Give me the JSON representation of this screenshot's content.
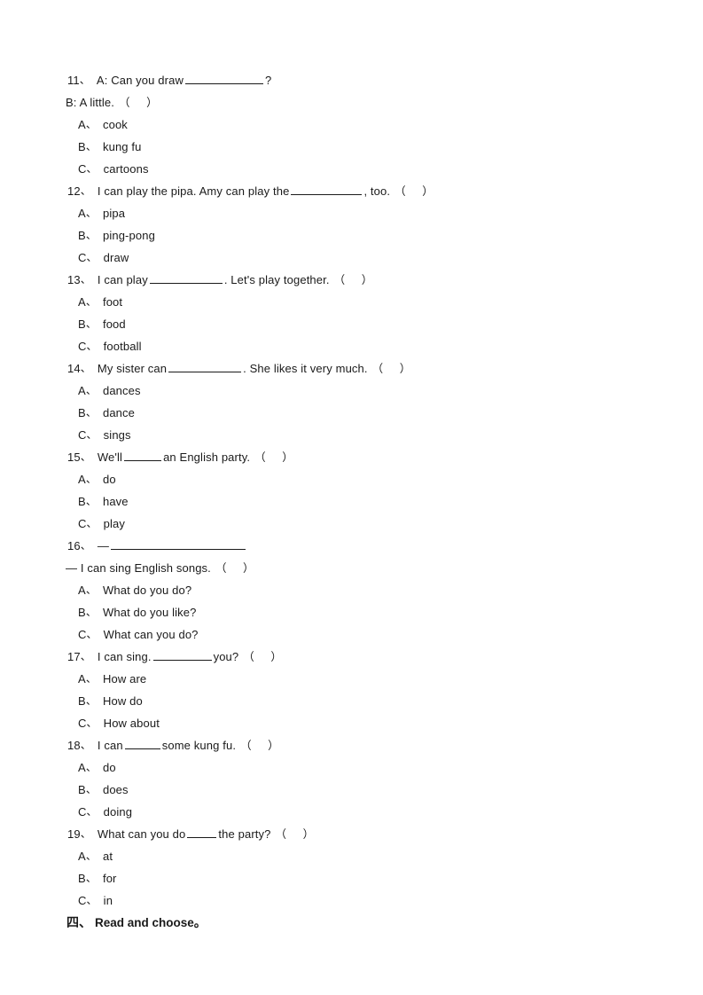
{
  "document": {
    "questions": [
      {
        "number": "11",
        "sep": "、",
        "stem_before": "A: Can you draw",
        "blank_width": 88,
        "stem_after": "?",
        "continuation": "B: A little.",
        "has_bracket_on_continuation": true,
        "options": [
          {
            "letter": "A",
            "sep": "、",
            "text": "cook"
          },
          {
            "letter": "B",
            "sep": "、",
            "text": "kung fu"
          },
          {
            "letter": "C",
            "sep": "、",
            "text": "cartoons"
          }
        ]
      },
      {
        "number": "12",
        "sep": "、",
        "stem_before": "I can play the pipa. Amy can play the",
        "blank_width": 80,
        "stem_after": ", too.",
        "options": [
          {
            "letter": "A",
            "sep": "、",
            "text": "pipa"
          },
          {
            "letter": "B",
            "sep": "、",
            "text": "ping-pong"
          },
          {
            "letter": "C",
            "sep": "、",
            "text": "draw"
          }
        ]
      },
      {
        "number": "13",
        "sep": "、",
        "stem_before": "I can play",
        "blank_width": 82,
        "stem_after": ". Let's play together.",
        "options": [
          {
            "letter": "A",
            "sep": "、",
            "text": "foot"
          },
          {
            "letter": "B",
            "sep": "、",
            "text": "food"
          },
          {
            "letter": "C",
            "sep": "、",
            "text": "football"
          }
        ]
      },
      {
        "number": "14",
        "sep": "、",
        "stem_before": "My sister can",
        "blank_width": 82,
        "stem_after": ". She likes it very much.",
        "options": [
          {
            "letter": "A",
            "sep": "、",
            "text": "dances"
          },
          {
            "letter": "B",
            "sep": "、",
            "text": "dance"
          },
          {
            "letter": "C",
            "sep": "、",
            "text": "sings"
          }
        ]
      },
      {
        "number": "15",
        "sep": "、",
        "stem_before": "We'll",
        "blank_width": 42,
        "stem_after": "an English party.",
        "options": [
          {
            "letter": "A",
            "sep": "、",
            "text": "do"
          },
          {
            "letter": "B",
            "sep": "、",
            "text": "have"
          },
          {
            "letter": "C",
            "sep": "、",
            "text": "play"
          }
        ]
      },
      {
        "number": "16",
        "sep": "、",
        "stem_before": "—",
        "blank_width": 152,
        "stem_after": "",
        "continuation": "— I can sing English songs.",
        "has_bracket_on_continuation": true,
        "options": [
          {
            "letter": "A",
            "sep": "、",
            "text": "What do you do?"
          },
          {
            "letter": "B",
            "sep": "、",
            "text": "What do you like?"
          },
          {
            "letter": "C",
            "sep": "、",
            "text": "What can you do?"
          }
        ]
      },
      {
        "number": "17",
        "sep": "、",
        "stem_before": "I can sing.",
        "blank_width": 66,
        "stem_after": "you?",
        "options": [
          {
            "letter": "A",
            "sep": "、",
            "text": "How are"
          },
          {
            "letter": "B",
            "sep": "、",
            "text": "How do"
          },
          {
            "letter": "C",
            "sep": "、",
            "text": "How about"
          }
        ]
      },
      {
        "number": "18",
        "sep": "、",
        "stem_before": "I can",
        "blank_width": 40,
        "stem_after": "some kung fu.",
        "options": [
          {
            "letter": "A",
            "sep": "、",
            "text": "do"
          },
          {
            "letter": "B",
            "sep": "、",
            "text": "does"
          },
          {
            "letter": "C",
            "sep": "、",
            "text": "doing"
          }
        ]
      },
      {
        "number": "19",
        "sep": "、",
        "stem_before": "What can you do",
        "blank_width": 33,
        "stem_after": "the party?",
        "options": [
          {
            "letter": "A",
            "sep": "、",
            "text": "at"
          },
          {
            "letter": "B",
            "sep": "、",
            "text": "for"
          },
          {
            "letter": "C",
            "sep": "、",
            "text": "in"
          }
        ]
      }
    ],
    "section_heading": {
      "marker": "四",
      "sep": "、",
      "title": "Read and choose",
      "period": "。"
    },
    "bracket": {
      "open": "（",
      "close": "）"
    }
  }
}
